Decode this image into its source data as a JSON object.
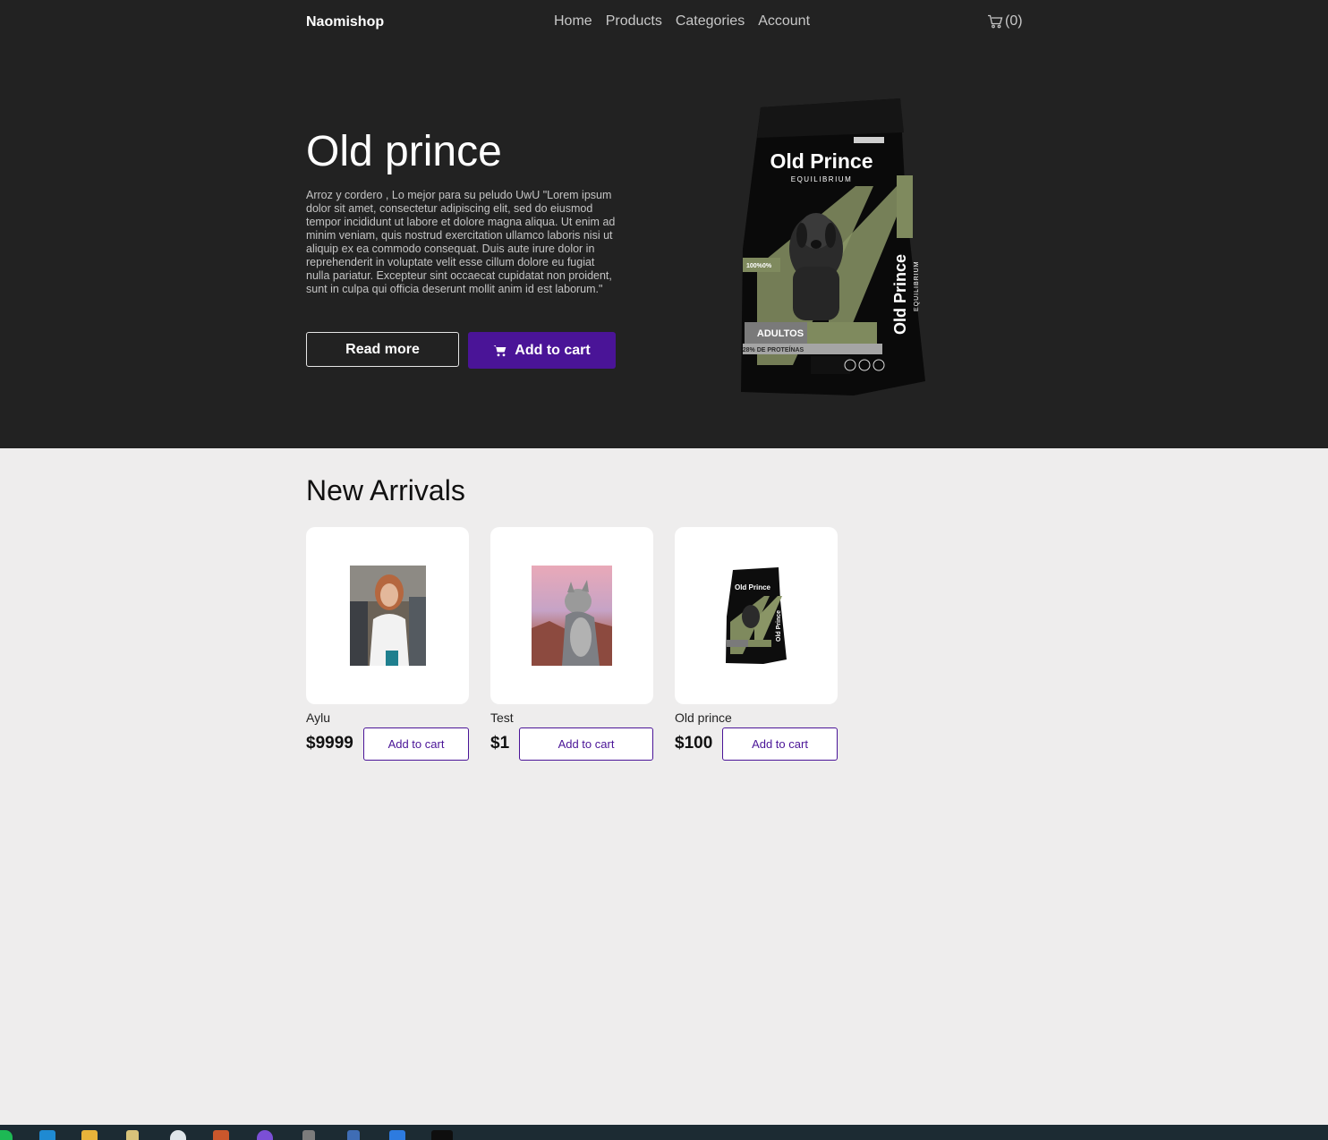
{
  "nav": {
    "brand": "Naomishop",
    "links": [
      "Home",
      "Products",
      "Categories",
      "Account"
    ],
    "cart_count": "(0)"
  },
  "hero": {
    "title": "Old prince",
    "description": "Arroz y cordero , Lo mejor para su peludo UwU \"Lorem ipsum dolor sit amet, consectetur adipiscing elit, sed do eiusmod tempor incididunt ut labore et dolore magna aliqua. Ut enim ad minim veniam, quis nostrud exercitation ullamco laboris nisi ut aliquip ex ea commodo consequat. Duis aute irure dolor in reprehenderit in voluptate velit esse cillum dolore eu fugiat nulla pariatur. Excepteur sint occaecat cupidatat non proident, sunt in culpa qui officia deserunt mollit anim id est laborum.\"",
    "read_more": "Read more",
    "add_to_cart": "Add to cart",
    "bag": {
      "brand": "Old Prince",
      "line": "EQUILIBRIUM",
      "stage": "ADULTOS",
      "protein": "28% DE PROTEÍNAS",
      "badge1": "100%",
      "badge2": "0%"
    }
  },
  "arrivals": {
    "title": "New Arrivals",
    "button_label": "Add to cart",
    "products": [
      {
        "name": "Aylu",
        "price": "$9999"
      },
      {
        "name": "Test",
        "price": "$1"
      },
      {
        "name": "Old prince",
        "price": "$100"
      }
    ]
  },
  "colors": {
    "hero_bg": "#222222",
    "accent": "#4a1497",
    "page_bg": "#eeeded"
  },
  "icons": [
    "cart-icon",
    "cart-icon-small"
  ]
}
